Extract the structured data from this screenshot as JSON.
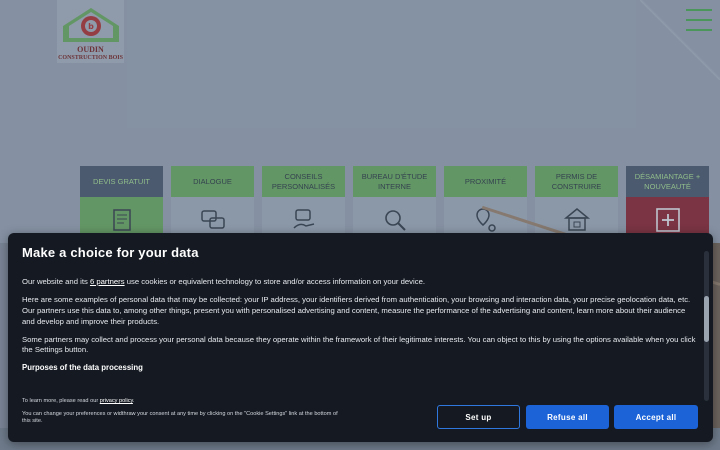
{
  "site": {
    "logo": {
      "line1": "OUDIN",
      "line2": "CONSTRUCTION BOIS"
    },
    "tiles": [
      {
        "label": "DEVIS GRATUIT",
        "icon": "form-icon"
      },
      {
        "label": "DIALOGUE",
        "icon": "chat-icon"
      },
      {
        "label": "CONSEILS PERSONNALISÉS",
        "icon": "advice-icon"
      },
      {
        "label": "BUREAU D'ÉTUDE INTERNE",
        "icon": "magnifier-icon"
      },
      {
        "label": "PROXIMITÉ",
        "icon": "location-icon"
      },
      {
        "label": "PERMIS DE CONSTRUIRE",
        "icon": "house-permit-icon"
      },
      {
        "label": "DÉSAMIANTAGE + NOUVEAUTÉ",
        "icon": "plus-icon"
      }
    ]
  },
  "consent": {
    "title": "Make a choice for your data",
    "p1_before": "Our website and its ",
    "p1_link": "6 partners",
    "p1_after": " use cookies or equivalent technology to store and/or access information on your device.",
    "p2": "Here are some examples of personal data that may be collected: your IP address, your identifiers derived from authentication, your browsing and interaction data, your precise geolocation data, etc.",
    "p3": "Our partners use this data to, among other things, present you with personalised advertising and content, measure the performance of the advertising and content, learn more about their audience and develop and improve their products.",
    "p4": "Some partners may collect and process your personal data because they operate within the framework of their legitimate interests. You can object to this by using the options available when you click the Settings button.",
    "purposes_heading": "Purposes of the data processing",
    "foot1_before": "To learn more, please read our ",
    "foot1_link": "privacy policy",
    "foot1_after": ".",
    "foot2": "You can change your preferences or widthraw your consent at any time by clicking on the \"Cookie Settings\" link at the bottom of this site.",
    "buttons": {
      "setup": "Set up",
      "refuse": "Refuse all",
      "accept": "Accept all"
    }
  },
  "colors": {
    "accent": "#1c63d8",
    "brand_green": "#5f9f57",
    "dialog_bg": "#151a22"
  }
}
